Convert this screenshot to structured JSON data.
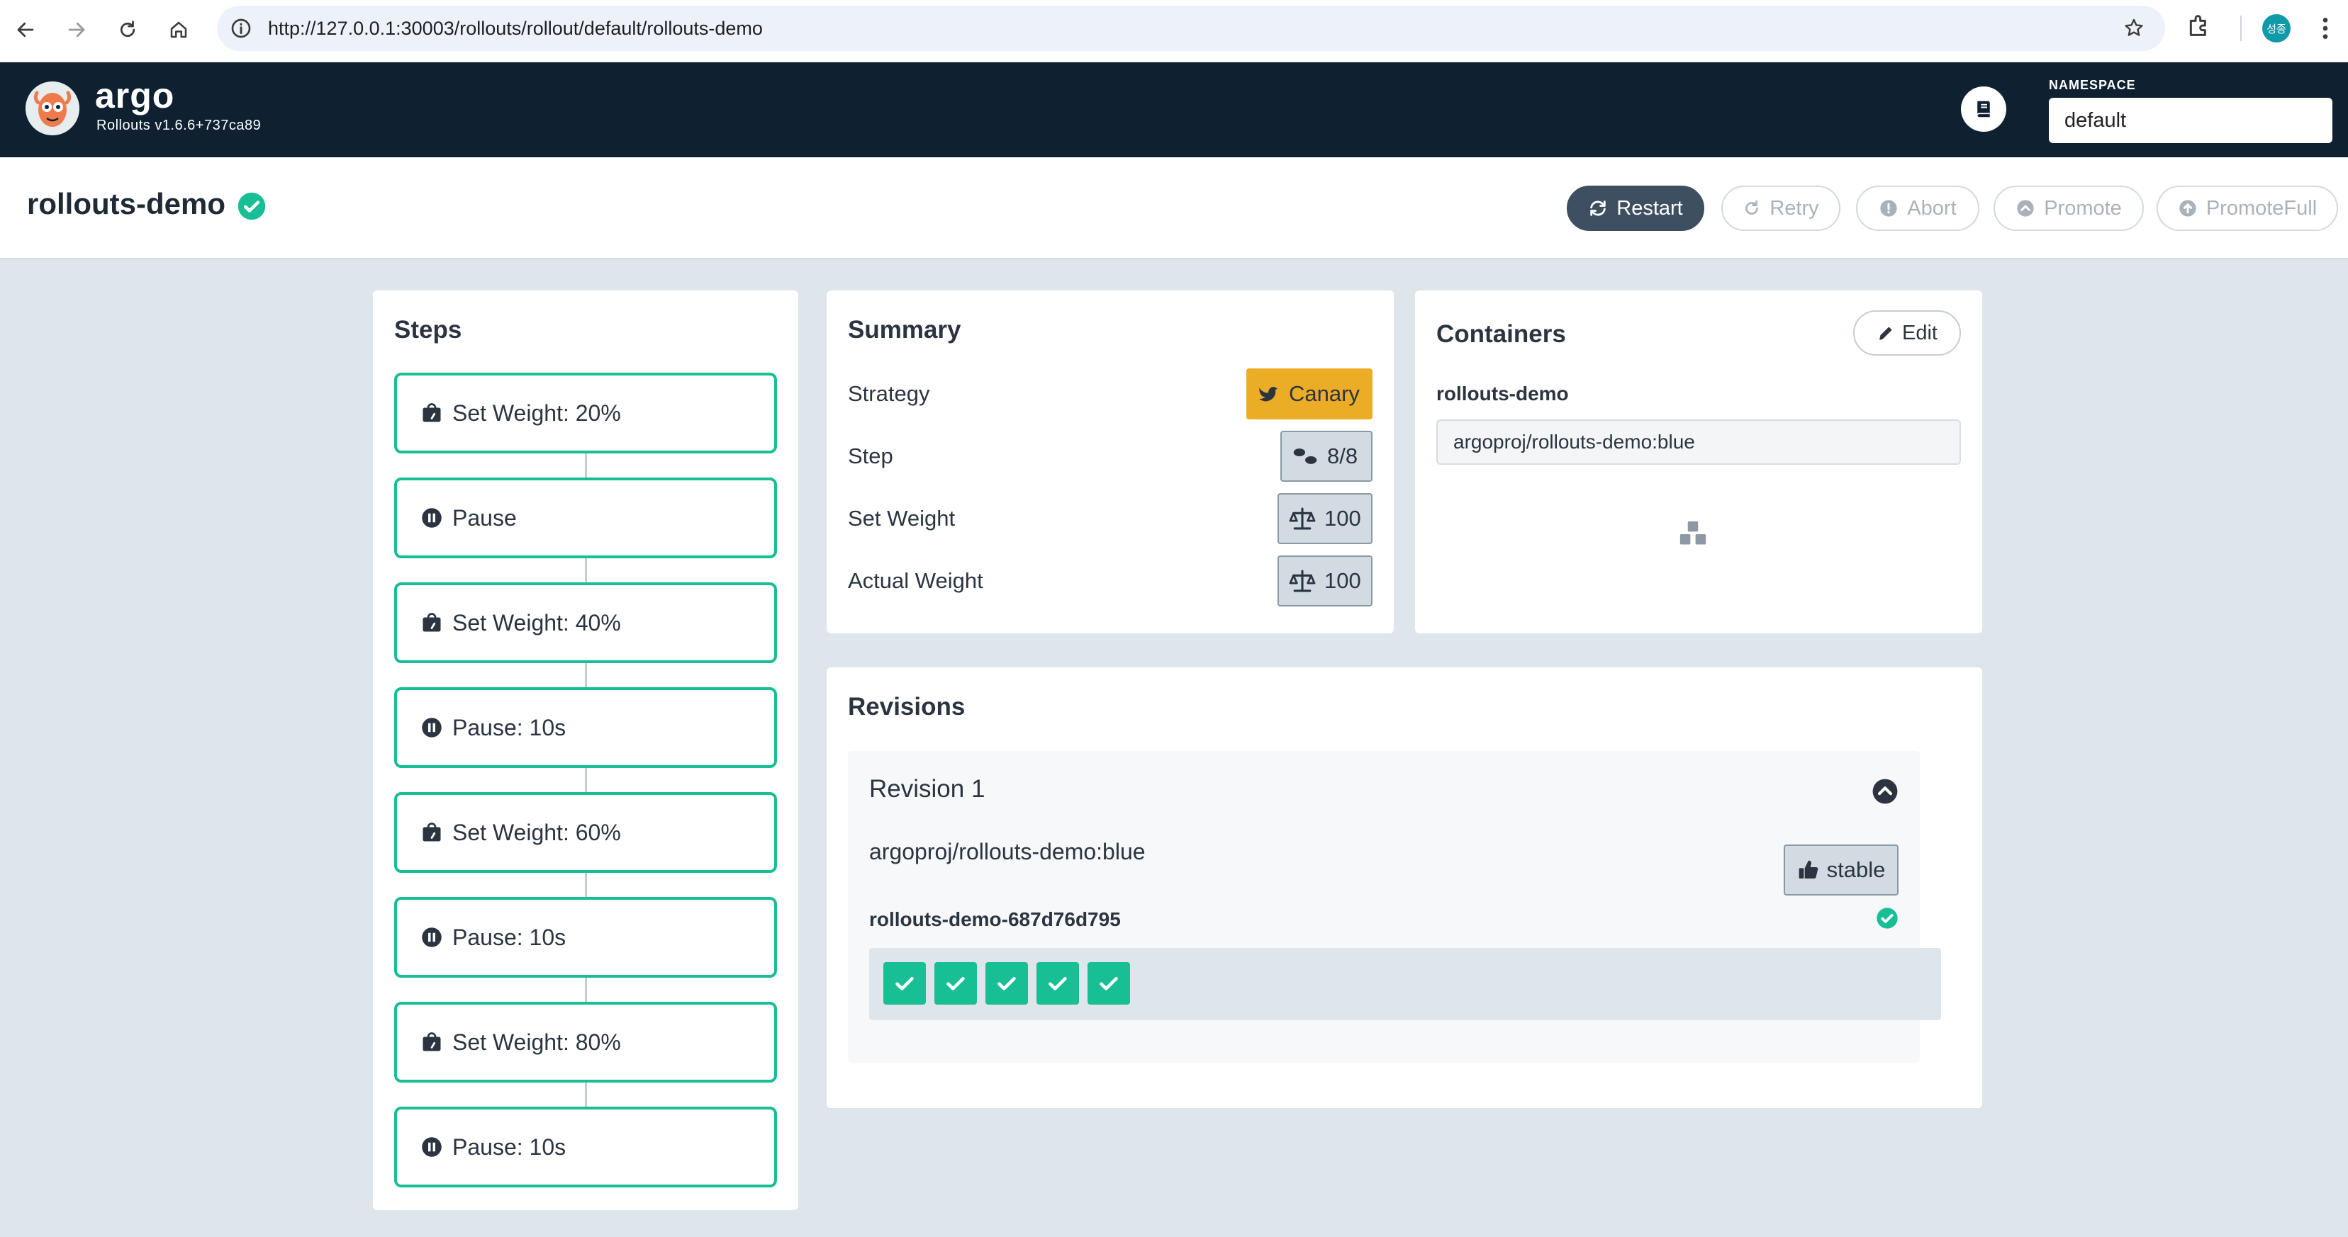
{
  "browser": {
    "url": "http://127.0.0.1:30003/rollouts/rollout/default/rollouts-demo",
    "profile_initials": "성종"
  },
  "header": {
    "app_name": "argo",
    "version": "Rollouts v1.6.6+737ca89",
    "namespace_label": "NAMESPACE",
    "namespace_value": "default"
  },
  "titlebar": {
    "title": "rollouts-demo",
    "actions": {
      "restart": "Restart",
      "retry": "Retry",
      "abort": "Abort",
      "promote": "Promote",
      "promote_full": "PromoteFull"
    }
  },
  "steps": {
    "title": "Steps",
    "items": [
      {
        "label": "Set Weight: 20%",
        "icon": "weight-icon"
      },
      {
        "label": "Pause",
        "icon": "pause-icon"
      },
      {
        "label": "Set Weight: 40%",
        "icon": "weight-icon"
      },
      {
        "label": "Pause: 10s",
        "icon": "pause-icon"
      },
      {
        "label": "Set Weight: 60%",
        "icon": "weight-icon"
      },
      {
        "label": "Pause: 10s",
        "icon": "pause-icon"
      },
      {
        "label": "Set Weight: 80%",
        "icon": "weight-icon"
      },
      {
        "label": "Pause: 10s",
        "icon": "pause-icon"
      }
    ]
  },
  "summary": {
    "title": "Summary",
    "strategy_label": "Strategy",
    "strategy_value": "Canary",
    "step_label": "Step",
    "step_value": "8/8",
    "set_weight_label": "Set Weight",
    "set_weight_value": "100",
    "actual_weight_label": "Actual Weight",
    "actual_weight_value": "100"
  },
  "containers": {
    "title": "Containers",
    "edit_label": "Edit",
    "name": "rollouts-demo",
    "image": "argoproj/rollouts-demo:blue"
  },
  "revisions": {
    "title": "Revisions",
    "items": [
      {
        "title": "Revision 1",
        "image": "argoproj/rollouts-demo:blue",
        "badge": "stable",
        "replicaset": "rollouts-demo-687d76d795",
        "pods": 5
      }
    ]
  },
  "colors": {
    "header_bg": "#0f2131",
    "accent_green": "#18be94",
    "canary_yellow": "#ebac26",
    "page_bg": "#dee6eb"
  }
}
